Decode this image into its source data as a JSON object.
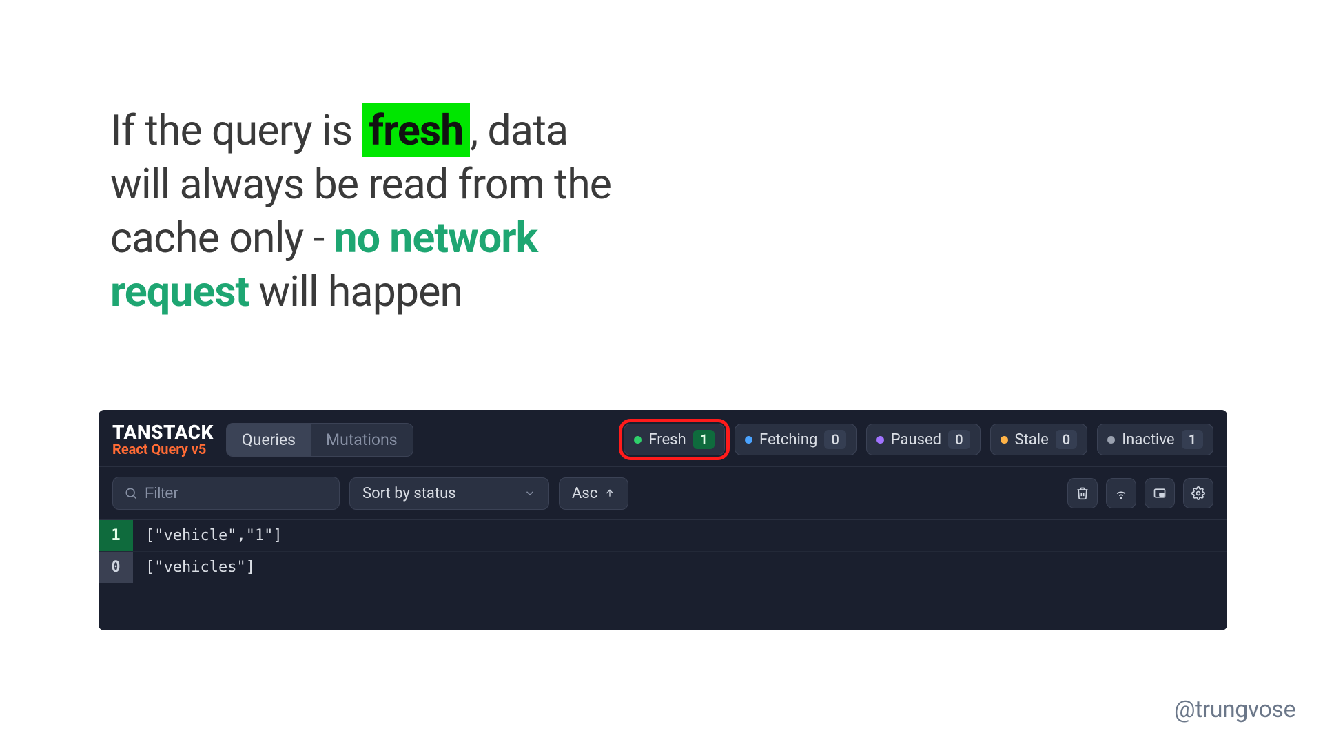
{
  "headline": {
    "part1": "If the query is ",
    "fresh_word": "fresh",
    "part2": ", data will always be read from the cache only - ",
    "emph": "no network request",
    "part3": " will happen"
  },
  "brand": {
    "top": "TANSTACK",
    "bottom": "React Query v5"
  },
  "tabs": {
    "queries": "Queries",
    "mutations": "Mutations"
  },
  "status": {
    "fresh": {
      "label": "Fresh",
      "count": "1"
    },
    "fetching": {
      "label": "Fetching",
      "count": "0"
    },
    "paused": {
      "label": "Paused",
      "count": "0"
    },
    "stale": {
      "label": "Stale",
      "count": "0"
    },
    "inactive": {
      "label": "Inactive",
      "count": "1"
    }
  },
  "toolbar": {
    "filter_placeholder": "Filter",
    "sort_label": "Sort by status",
    "dir_label": "Asc"
  },
  "queries": [
    {
      "count": "1",
      "state": "fresh",
      "key": "[\"vehicle\",\"1\"]"
    },
    {
      "count": "0",
      "state": "inactive",
      "key": "[\"vehicles\"]"
    }
  ],
  "watermark": "@trungvose"
}
